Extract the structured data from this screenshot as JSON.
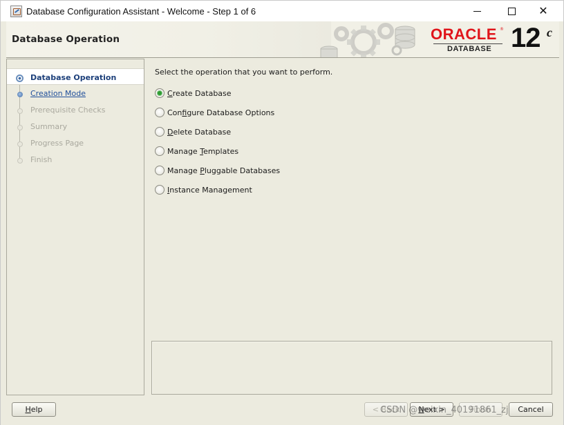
{
  "window": {
    "title": "Database Configuration Assistant - Welcome - Step 1 of 6",
    "icon": "dbca-app-icon",
    "controls": {
      "minimize": "minimize-icon",
      "maximize": "maximize-icon",
      "close": "close-icon"
    }
  },
  "header": {
    "page_title": "Database Operation",
    "logo": {
      "word": "ORACLE",
      "reg": "®",
      "product": "DATABASE",
      "version": "12",
      "version_suffix": "c"
    }
  },
  "nav": {
    "items": [
      {
        "label": "Database Operation",
        "state": "current"
      },
      {
        "label": "Creation Mode",
        "state": "link"
      },
      {
        "label": "Prerequisite Checks",
        "state": "disabled"
      },
      {
        "label": "Summary",
        "state": "disabled"
      },
      {
        "label": "Progress Page",
        "state": "disabled"
      },
      {
        "label": "Finish",
        "state": "disabled"
      }
    ]
  },
  "main": {
    "prompt": "Select the operation that you want to perform.",
    "options": [
      {
        "mnemonic": "C",
        "rest": "reate Database",
        "checked": true
      },
      {
        "pre": "Con",
        "mnemonic": "f",
        "rest": "igure Database Options",
        "checked": false
      },
      {
        "mnemonic": "D",
        "rest": "elete Database",
        "checked": false
      },
      {
        "pre": "Manage ",
        "mnemonic": "T",
        "rest": "emplates",
        "checked": false
      },
      {
        "pre": "Manage ",
        "mnemonic": "P",
        "rest": "luggable Databases",
        "checked": false
      },
      {
        "mnemonic": "I",
        "rest": "nstance Management",
        "checked": false
      }
    ]
  },
  "buttons": {
    "help": {
      "mnemonic": "H",
      "rest": "elp"
    },
    "back": "< Back",
    "next": {
      "mnemonic": "N",
      "rest": "ext >"
    },
    "finish": "Finish",
    "cancel": "Cancel"
  },
  "watermark": "CSDN @weixin_40191861_zj",
  "colors": {
    "accent_green": "#2f9b33",
    "link_blue": "#1f4e9a",
    "oracle_red": "#e0151b",
    "panel_bg": "#ecebdf"
  }
}
